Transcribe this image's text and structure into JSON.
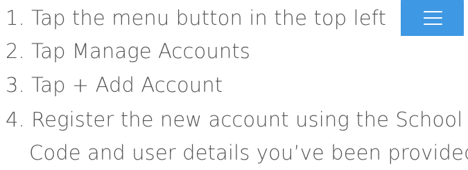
{
  "instructions": {
    "steps": [
      {
        "label": "1. Tap the menu button in the top left"
      },
      {
        "label": "2. Tap Manage Accounts"
      },
      {
        "label": "3. Tap + Add Account"
      },
      {
        "label": "4. Register the new account using the School",
        "continuation": "Code and user details you’ve been provided."
      }
    ]
  },
  "menu_button": {
    "icon": "hamburger-menu-icon",
    "color": "#3f98e3"
  }
}
